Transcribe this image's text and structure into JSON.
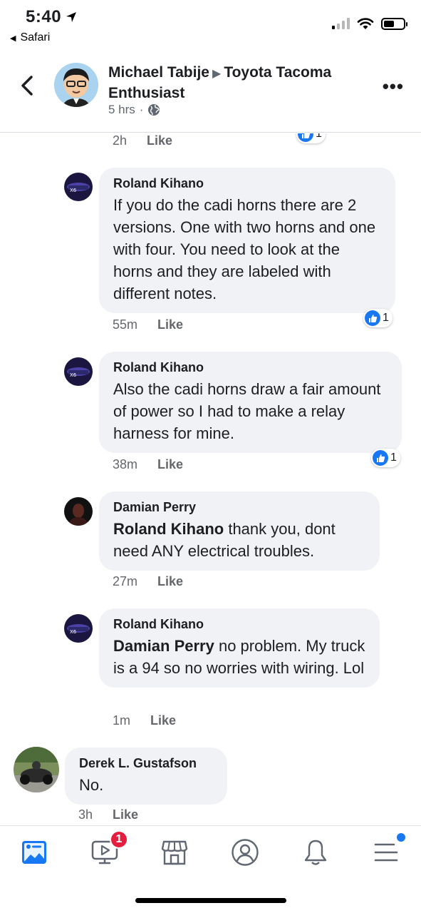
{
  "status_bar": {
    "time": "5:40",
    "back_app": "Safari"
  },
  "header": {
    "author": "Michael Tabije",
    "group": "Toyota Tacoma Enthusiast",
    "time": "5 hrs",
    "separator": "·",
    "more": "•••"
  },
  "comments": [
    {
      "meta_time": "2h",
      "like": "Like",
      "reaction_count": "1"
    },
    {
      "name": "Roland Kihano",
      "mention": "",
      "text": "If you do the cadi horns there are 2 versions. One with two horns and one with four. You need to look at the horns and they are labeled with different notes.",
      "time": "55m",
      "like": "Like",
      "reaction_count": "1"
    },
    {
      "name": "Roland Kihano",
      "mention": "",
      "text": "Also the cadi horns draw a fair amount of power so I had to make a relay harness for mine.",
      "time": "38m",
      "like": "Like",
      "reaction_count": "1"
    },
    {
      "name": "Damian Perry",
      "mention": "Roland Kihano",
      "text": " thank you, dont need ANY electrical troubles.",
      "time": "27m",
      "like": "Like"
    },
    {
      "name": "Roland Kihano",
      "mention": "Damian Perry",
      "text": " no problem. My truck is a 94 so no worries with wiring. Lol",
      "time": "1m",
      "like": "Like"
    },
    {
      "name": "Derek L. Gustafson",
      "mention": "",
      "text": "No.",
      "time": "3h",
      "like": "Like"
    }
  ],
  "bottom_nav": {
    "watch_badge": "1"
  },
  "colors": {
    "accent": "#1877f2",
    "badge": "#e41e3f",
    "bubble": "#f0f2f5",
    "meta": "#65676b"
  }
}
